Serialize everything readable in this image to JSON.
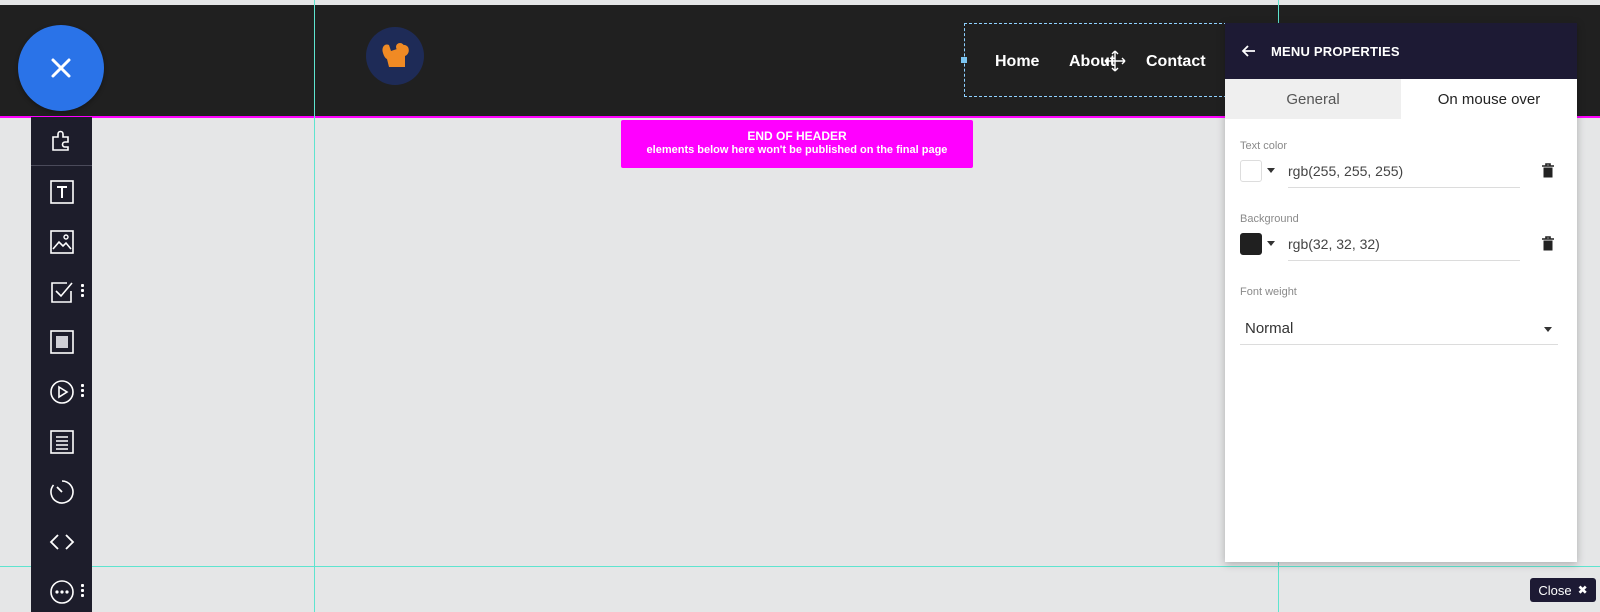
{
  "header": {
    "nav": [
      "Home",
      "About",
      "Contact"
    ]
  },
  "end_of_header": {
    "title": "END OF HEADER",
    "subtitle": "elements below here won't be published on the final page"
  },
  "toolbar": {
    "tools": [
      "puzzle-icon",
      "text-icon",
      "image-icon",
      "checkbox-icon",
      "square-icon",
      "play-icon",
      "list-icon",
      "timer-icon",
      "code-icon",
      "more-icon"
    ]
  },
  "panel": {
    "title": "MENU PROPERTIES",
    "tabs": [
      "General",
      "On mouse over"
    ],
    "text_color": {
      "label": "Text color",
      "value": "rgb(255, 255, 255)",
      "swatch": "#ffffff"
    },
    "background": {
      "label": "Background",
      "value": "rgb(32, 32, 32)",
      "swatch": "#202020"
    },
    "font_weight": {
      "label": "Font weight",
      "value": "Normal"
    }
  },
  "close_button": {
    "label": "Close"
  },
  "colors": {
    "header": "#202020",
    "magenta": "#ff00ff",
    "fab": "#2a73e8",
    "panel_header": "#1d1a34",
    "guide": "#5ee4cf"
  }
}
